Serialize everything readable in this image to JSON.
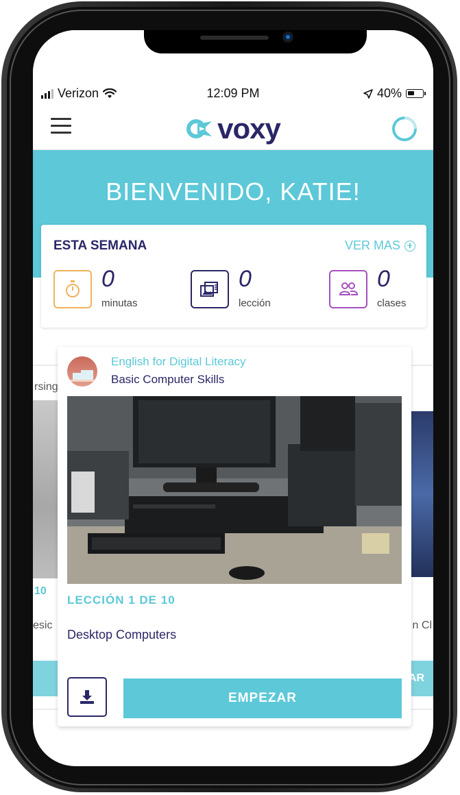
{
  "status_bar": {
    "carrier": "Verizon",
    "time": "12:09 PM",
    "battery_percent": "40%",
    "icons": [
      "signal-icon",
      "wifi-icon",
      "location-arrow-icon",
      "battery-icon"
    ]
  },
  "app_bar": {
    "logo_text": "voxy",
    "menu_icon": "hamburger-menu-icon",
    "progress_icon": "progress-ring-icon"
  },
  "welcome": {
    "title": "BIENVENIDO, KATIE!"
  },
  "week": {
    "title": "ESTA SEMANA",
    "more_label": "VER MAS",
    "stats": [
      {
        "value": "0",
        "label": "minutas",
        "icon": "stopwatch-icon",
        "color": "#f0b25a"
      },
      {
        "value": "0",
        "label": "lección",
        "icon": "lesson-images-icon",
        "color": "#2a2667"
      },
      {
        "value": "0",
        "label": "clases",
        "icon": "group-users-icon",
        "color": "#a64fbf"
      }
    ]
  },
  "side_cards": {
    "left_snippet_top": "rsing",
    "left_snippet_num": "10",
    "left_snippet_bottom": "esic",
    "right_snippet_bottom": "n Cl",
    "right_button_snippet": "AR"
  },
  "lesson_card": {
    "course_title": "English for Digital Literacy",
    "course_subtitle": "Basic Computer Skills",
    "lesson_label": "LECCIÓN 1 DE 10",
    "lesson_name": "Desktop Computers",
    "start_label": "EMPEZAR",
    "download_icon": "download-icon"
  },
  "colors": {
    "brand_teal": "#5cc8d8",
    "brand_navy": "#2a2667"
  }
}
